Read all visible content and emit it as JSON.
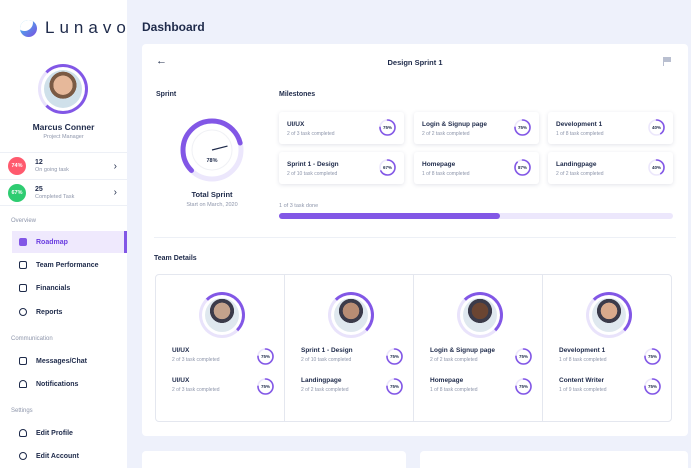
{
  "app": {
    "name": "Lunavo"
  },
  "page": {
    "title": "Dashboard"
  },
  "profile": {
    "name": "Marcus Conner",
    "role": "Project Manager"
  },
  "stats": [
    {
      "badge": "74%",
      "count": "12",
      "label": "On going task",
      "color": "#ff5a6e"
    },
    {
      "badge": "67%",
      "count": "25",
      "label": "Completed Task",
      "color": "#2ecc71"
    }
  ],
  "nav": {
    "overview_label": "Overview",
    "overview_items": [
      {
        "label": "Roadmap",
        "icon": "roadmap-icon"
      },
      {
        "label": "Team Performance",
        "icon": "chart-icon"
      },
      {
        "label": "Financials",
        "icon": "wallet-icon"
      },
      {
        "label": "Reports",
        "icon": "pie-chart-icon"
      }
    ],
    "communication_label": "Communication",
    "communication_items": [
      {
        "label": "Messages/Chat",
        "icon": "chat-icon"
      },
      {
        "label": "Notifications",
        "icon": "bell-icon"
      }
    ],
    "settings_label": "Settings",
    "settings_items": [
      {
        "label": "Edit Profile",
        "icon": "user-icon"
      },
      {
        "label": "Edit Account",
        "icon": "gear-icon"
      }
    ]
  },
  "sprint": {
    "header": "Design Sprint 1",
    "section_label": "Sprint",
    "gauge_value": 78,
    "gauge_label": "78%",
    "total_label": "Total Sprint",
    "start_label": "Start on March, 2020"
  },
  "milestones": {
    "label": "Milestones",
    "items": [
      {
        "title": "UI/UX",
        "sub": "2 of 3 task completed",
        "pct": 75,
        "pct_label": "75%"
      },
      {
        "title": "Login & Signup page",
        "sub": "2 of 2 task completed",
        "pct": 75,
        "pct_label": "75%"
      },
      {
        "title": "Development 1",
        "sub": "1 of 8 task completed",
        "pct": 40,
        "pct_label": "40%"
      },
      {
        "title": "Sprint 1 - Design",
        "sub": "2 of 10 task completed",
        "pct": 67,
        "pct_label": "67%"
      },
      {
        "title": "Homepage",
        "sub": "1 of 8 task completed",
        "pct": 87,
        "pct_label": "87%"
      },
      {
        "title": "Landingpage",
        "sub": "2 of 2 task completed",
        "pct": 40,
        "pct_label": "40%"
      }
    ],
    "progress_label": "1 of 3 task done",
    "progress_value": 0.56
  },
  "team": {
    "label": "Team Details",
    "members": [
      {
        "avatar": "#c3a28c",
        "tasks": [
          {
            "title": "UI/UX",
            "sub": "2 of 3 task completed",
            "pct": 75,
            "pct_label": "75%"
          },
          {
            "title": "UI/UX",
            "sub": "2 of 3 task completed",
            "pct": 75,
            "pct_label": "75%"
          }
        ]
      },
      {
        "avatar": "#b88d74",
        "tasks": [
          {
            "title": "Sprint 1 - Design",
            "sub": "2 of 10 task completed",
            "pct": 75,
            "pct_label": "75%"
          },
          {
            "title": "Landingpage",
            "sub": "2 of 2 task completed",
            "pct": 75,
            "pct_label": "75%"
          }
        ]
      },
      {
        "avatar": "#6b4532",
        "tasks": [
          {
            "title": "Login & Signup page",
            "sub": "2 of 2 task completed",
            "pct": 75,
            "pct_label": "75%"
          },
          {
            "title": "Homepage",
            "sub": "1 of 8 task completed",
            "pct": 75,
            "pct_label": "75%"
          }
        ]
      },
      {
        "avatar": "#d9aa8c",
        "tasks": [
          {
            "title": "Development 1",
            "sub": "1 of 8 task completed",
            "pct": 75,
            "pct_label": "75%"
          },
          {
            "title": "Content Writer",
            "sub": "1 of 9 task completed",
            "pct": 75,
            "pct_label": "75%"
          }
        ]
      }
    ]
  }
}
